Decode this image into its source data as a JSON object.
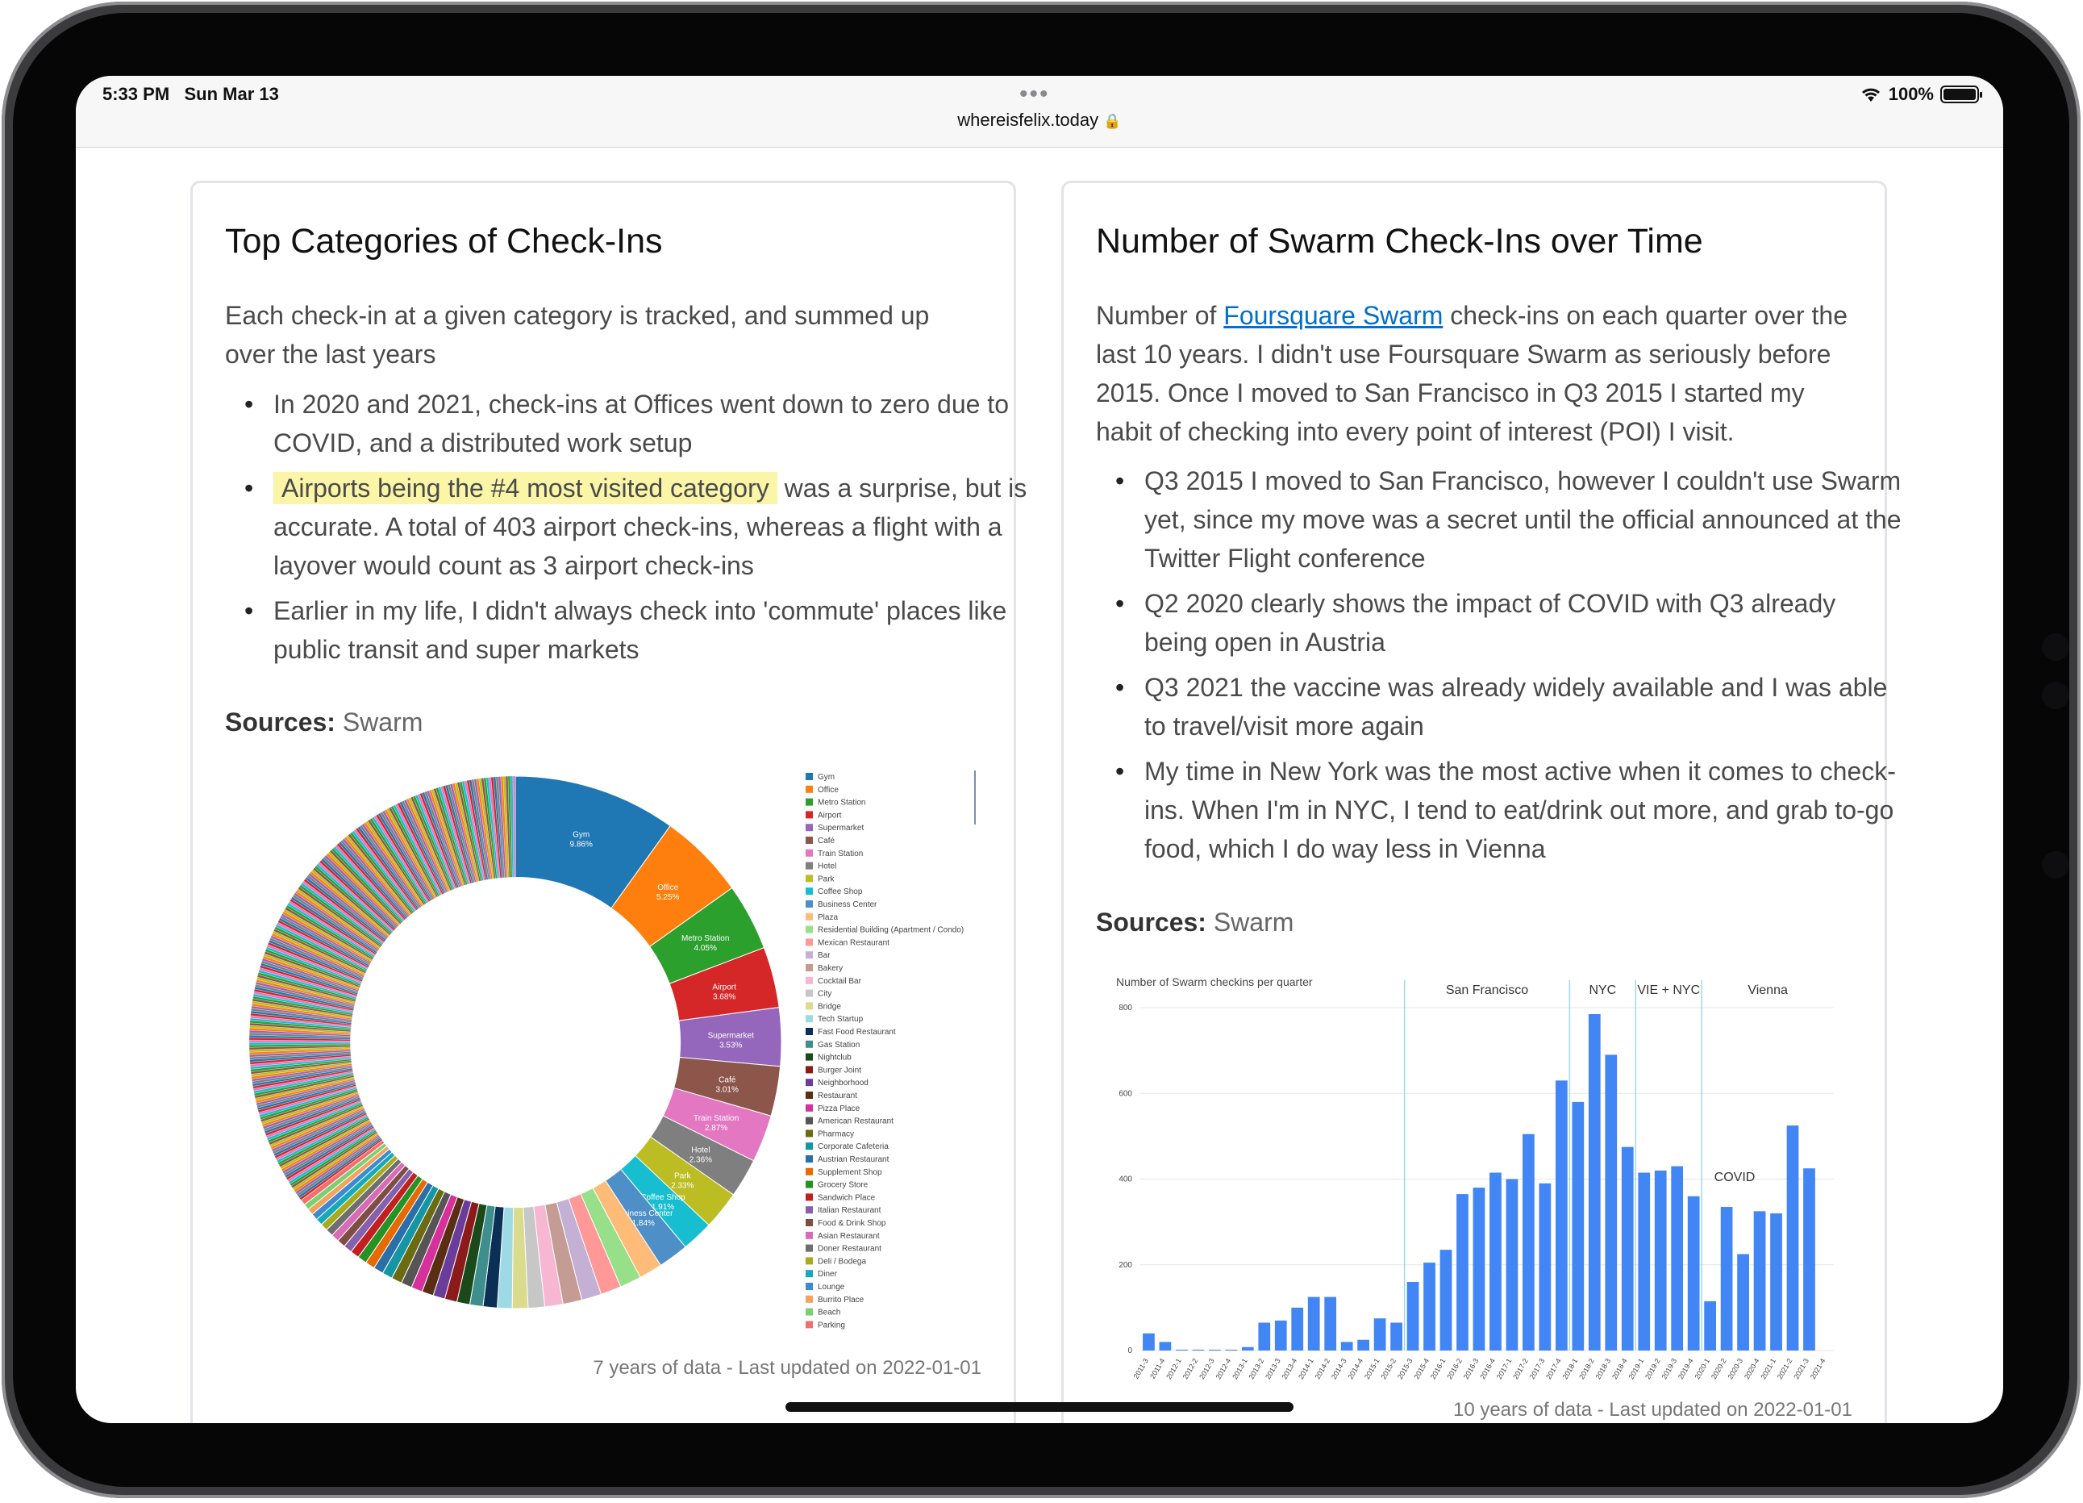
{
  "status": {
    "time": "5:33 PM",
    "date": "Sun Mar 13",
    "url": "whereisfelix.today",
    "battery": "100%"
  },
  "left": {
    "title": "Top Categories of Check-Ins",
    "intro": "Each check-in at a given category is tracked, and summed up over the last years",
    "bullets": [
      "In 2020 and 2021, check-ins at Offices went down to zero due to COVID, and a distributed work setup",
      " was a surprise, but is accurate. A total of 403 airport check-ins, whereas a flight with a layover would count as 3 airport check-ins",
      "Earlier in my life, I didn't always check into 'commute' places like public transit and super markets"
    ],
    "highlight": "Airports being the #4 most visited category",
    "sources_label": "Sources:",
    "sources": "Swarm",
    "footer": "7 years of data - Last updated on 2022-01-01"
  },
  "right": {
    "title": "Number of Swarm Check-Ins over Time",
    "intro_pre": "Number of ",
    "intro_link": "Foursquare Swarm",
    "intro_post": " check-ins on each quarter over the last 10 years. I didn't use Foursquare Swarm as seriously before 2015. Once I moved to San Francisco in Q3 2015 I started my habit of checking into every point of interest (POI) I visit.",
    "bullets": [
      "Q3 2015 I moved to San Francisco, however I couldn't use Swarm yet, since my move was a secret until the official announced at the Twitter Flight conference",
      "Q2 2020 clearly shows the impact of COVID with Q3 already being open in Austria",
      "Q3 2021 the vaccine was already widely available and I was able to travel/visit more again",
      "My time in New York was the most active when it comes to check-ins. When I'm in NYC, I tend to eat/drink out more, and grab to-go food, which I do way less in Vienna"
    ],
    "sources_label": "Sources:",
    "sources": "Swarm",
    "footer": "10 years of data - Last updated on 2022-01-01"
  },
  "chart_data": [
    {
      "type": "pie",
      "hole": 0.62,
      "title": "",
      "top_slices": [
        {
          "label": "Gym",
          "value": 9.86,
          "color": "#1f77b4"
        },
        {
          "label": "Office",
          "value": 5.25,
          "color": "#ff7f0e"
        },
        {
          "label": "Metro Station",
          "value": 4.05,
          "color": "#2ca02c"
        },
        {
          "label": "Airport",
          "value": 3.68,
          "color": "#d62728"
        },
        {
          "label": "Supermarket",
          "value": 3.53,
          "color": "#9467bd"
        },
        {
          "label": "Café",
          "value": 3.01,
          "color": "#8c564b"
        },
        {
          "label": "Train Station",
          "value": 2.87,
          "color": "#e377c2"
        },
        {
          "label": "Hotel",
          "value": 2.36,
          "color": "#7f7f7f"
        },
        {
          "label": "Park",
          "value": 2.33,
          "color": "#bcbd22"
        },
        {
          "label": "Coffee Shop",
          "value": 1.91,
          "color": "#17becf"
        },
        {
          "label": "Business Center",
          "value": 1.84,
          "color": "#4f8fc7"
        },
        {
          "label": "Plaza",
          "value": 1.41,
          "color": "#ffbb78"
        },
        {
          "label": "Residential Building (Apartment / Condo)",
          "value": 1.3,
          "color": "#98df8a"
        },
        {
          "label": "Mexican Restaurant",
          "value": 1.25,
          "color": "#ff9896"
        },
        {
          "label": "Bar",
          "value": 1.2,
          "color": "#c5b0d5"
        },
        {
          "label": "Bakery",
          "value": 1.15,
          "color": "#c49c94"
        },
        {
          "label": "Cocktail Bar",
          "value": 1.1,
          "color": "#f7b6d2"
        },
        {
          "label": "City",
          "value": 1.0,
          "color": "#c7c7c7"
        },
        {
          "label": "Bridge",
          "value": 0.95,
          "color": "#dbdb8d"
        },
        {
          "label": "Tech Startup",
          "value": 0.9,
          "color": "#9edae5"
        },
        {
          "label": "Fast Food Restaurant",
          "value": 0.85,
          "color": "#0b2f55"
        },
        {
          "label": "Gas Station",
          "value": 0.8,
          "color": "#3e8e8e"
        },
        {
          "label": "Nightclub",
          "value": 0.78,
          "color": "#1a4a1a"
        },
        {
          "label": "Burger Joint",
          "value": 0.75,
          "color": "#8b1a1a"
        },
        {
          "label": "Neighborhood",
          "value": 0.72,
          "color": "#6a3d9a"
        },
        {
          "label": "Restaurant",
          "value": 0.7,
          "color": "#5a2e12"
        },
        {
          "label": "Pizza Place",
          "value": 0.68,
          "color": "#d6309b"
        },
        {
          "label": "American Restaurant",
          "value": 0.66,
          "color": "#555555"
        },
        {
          "label": "Pharmacy",
          "value": 0.64,
          "color": "#6b6b12"
        },
        {
          "label": "Corporate Cafeteria",
          "value": 0.62,
          "color": "#1596a5"
        },
        {
          "label": "Austrian Restaurant",
          "value": 0.6,
          "color": "#2a6fa8"
        },
        {
          "label": "Supplement Shop",
          "value": 0.58,
          "color": "#e66a00"
        },
        {
          "label": "Grocery Store",
          "value": 0.56,
          "color": "#259225"
        },
        {
          "label": "Sandwich Place",
          "value": 0.54,
          "color": "#c22020"
        },
        {
          "label": "Italian Restaurant",
          "value": 0.52,
          "color": "#8560ad"
        },
        {
          "label": "Food & Drink Shop",
          "value": 0.5,
          "color": "#7e4d43"
        },
        {
          "label": "Asian Restaurant",
          "value": 0.48,
          "color": "#d86bb5"
        },
        {
          "label": "Doner Restaurant",
          "value": 0.46,
          "color": "#6e6e6e"
        },
        {
          "label": "Deli / Bodega",
          "value": 0.44,
          "color": "#a9aa1e"
        },
        {
          "label": "Diner",
          "value": 0.42,
          "color": "#15aabb"
        },
        {
          "label": "Lounge",
          "value": 0.4,
          "color": "#3d8ad1"
        },
        {
          "label": "Burrito Place",
          "value": 0.38,
          "color": "#f2a35c"
        },
        {
          "label": "Beach",
          "value": 0.36,
          "color": "#7ad070"
        },
        {
          "label": "Parking",
          "value": 0.34,
          "color": "#f07070"
        }
      ],
      "long_tail_share": 35.0
    },
    {
      "type": "bar",
      "title": "Number of Swarm checkins per quarter",
      "color": "#4285f4",
      "ylim": [
        0,
        800
      ],
      "yticks": [
        0,
        200,
        400,
        600,
        800
      ],
      "categories": [
        "2011-3",
        "2011-4",
        "2012-1",
        "2012-2",
        "2012-3",
        "2012-4",
        "2013-1",
        "2013-2",
        "2013-3",
        "2013-4",
        "2014-1",
        "2014-2",
        "2014-3",
        "2014-4",
        "2015-1",
        "2015-2",
        "2015-3",
        "2015-4",
        "2016-1",
        "2016-2",
        "2016-3",
        "2016-4",
        "2017-1",
        "2017-2",
        "2017-3",
        "2017-4",
        "2018-1",
        "2018-2",
        "2018-3",
        "2018-4",
        "2019-1",
        "2019-2",
        "2019-3",
        "2019-4",
        "2020-1",
        "2020-2",
        "2020-3",
        "2020-4",
        "2021-1",
        "2021-2",
        "2021-3",
        "2021-4"
      ],
      "values": [
        40,
        20,
        2,
        2,
        2,
        2,
        8,
        65,
        70,
        100,
        125,
        125,
        20,
        25,
        75,
        65,
        160,
        205,
        235,
        365,
        380,
        415,
        400,
        505,
        390,
        630,
        580,
        785,
        690,
        475,
        415,
        420,
        430,
        360,
        115,
        335,
        225,
        325,
        320,
        525,
        425,
        0
      ],
      "eras": [
        {
          "label": "San Francisco",
          "from": "2015-3",
          "to": "2017-4"
        },
        {
          "label": "NYC",
          "from": "2018-1",
          "to": "2018-4"
        },
        {
          "label": "VIE + NYC",
          "from": "2019-1",
          "to": "2019-4"
        },
        {
          "label": "Vienna",
          "from": "2020-1",
          "to": "2021-4"
        }
      ],
      "annotations": [
        {
          "label": "COVID",
          "at": "2020-2"
        }
      ]
    }
  ]
}
